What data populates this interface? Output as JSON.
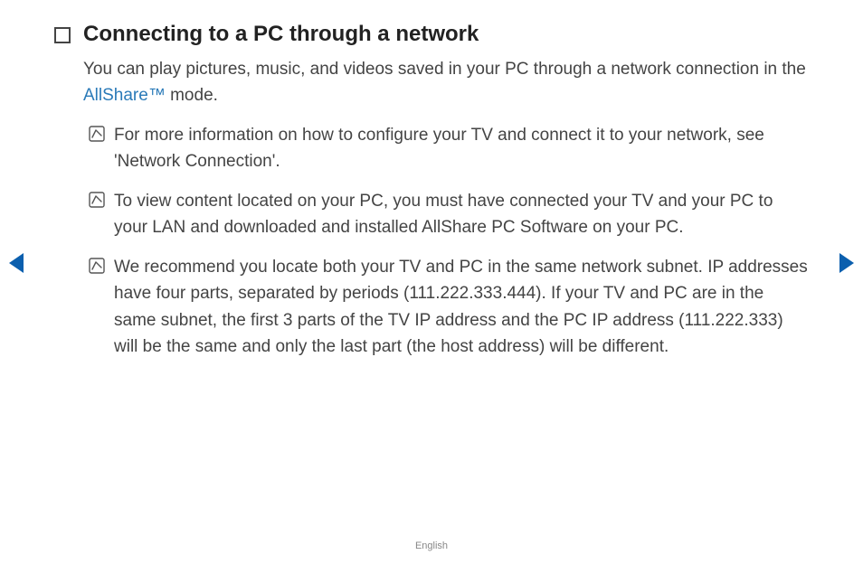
{
  "title": "Connecting to a PC through a network",
  "intro_before": "You can play pictures, music, and videos saved in your PC through a network connection in the ",
  "allshare": "AllShare™",
  "intro_after": " mode.",
  "notes": [
    "For more information on how to configure your TV and connect it to your network, see 'Network Connection'.",
    "To view content located on your PC, you must have connected your TV and your PC to your LAN and downloaded and installed AllShare PC Software on your PC.",
    "We recommend you locate both your TV and PC in the same network subnet. IP addresses have four parts, separated by periods (111.222.333.444). If your TV and PC are in the same subnet, the first 3 parts of the TV IP address and the PC IP address (111.222.333) will be the same and only the last part (the host address) will be different."
  ],
  "footer": "English"
}
